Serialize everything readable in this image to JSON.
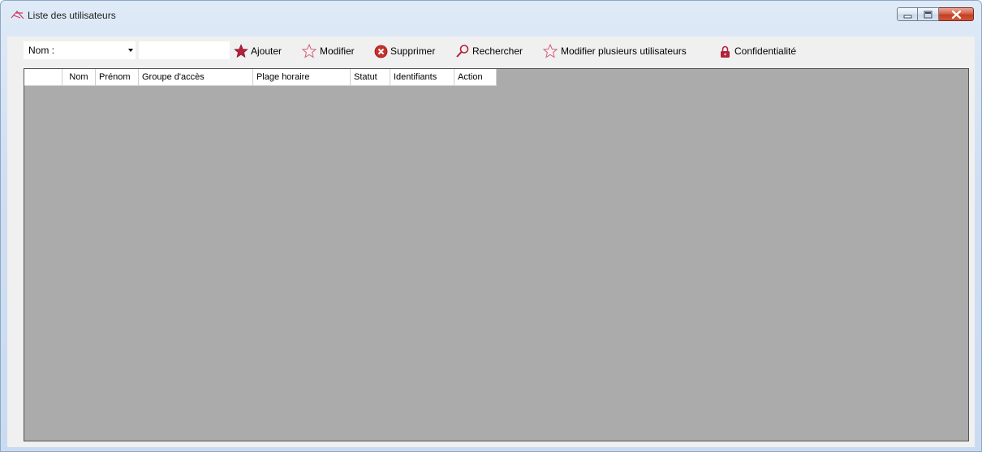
{
  "window": {
    "title": "Liste des utilisateurs"
  },
  "toolbar": {
    "filter_field": "Nom :",
    "search_value": "",
    "buttons": {
      "add": "Ajouter",
      "edit": "Modifier",
      "delete": "Supprimer",
      "search": "Rechercher",
      "edit_multiple": "Modifier plusieurs utilisateurs",
      "privacy": "Confidentialité"
    }
  },
  "grid": {
    "columns": [
      "Nom",
      "Prénom",
      "Groupe d'accès",
      "Plage horaire",
      "Statut",
      "Identifiants",
      "Action"
    ],
    "rows": []
  },
  "colors": {
    "grid_background": "#ababab",
    "accent_red": "#b3213a",
    "delete_red": "#c9302c"
  }
}
